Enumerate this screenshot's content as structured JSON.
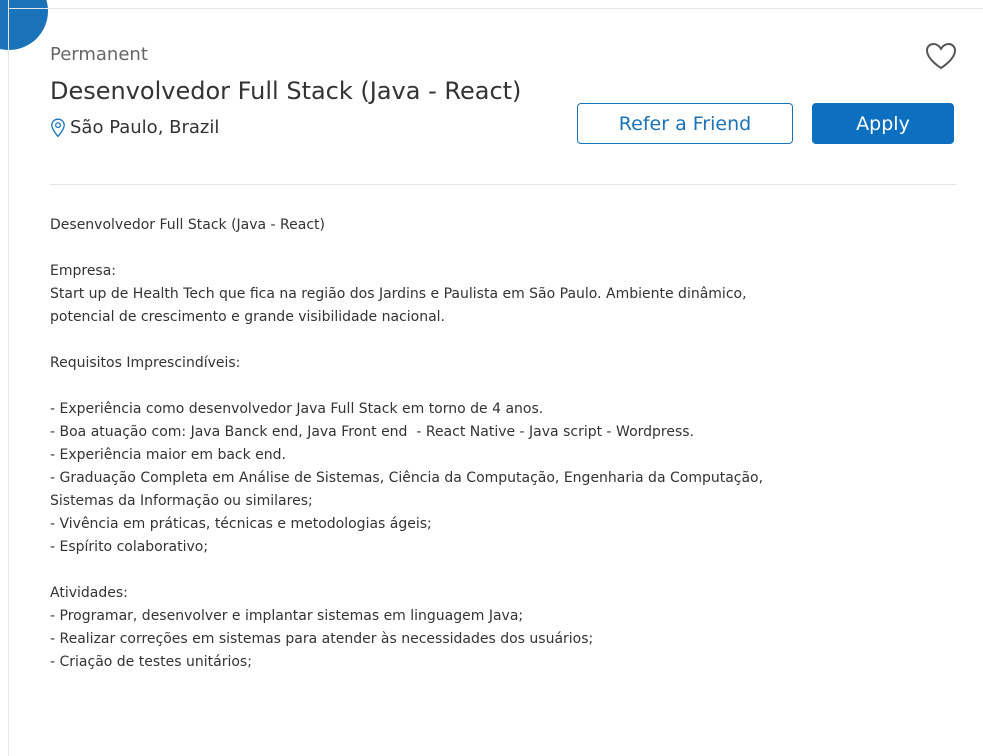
{
  "job": {
    "type": "Permanent",
    "title": "Desenvolvedor Full Stack (Java - React)",
    "location": "São Paulo, Brazil"
  },
  "actions": {
    "refer_label": "Refer a Friend",
    "apply_label": "Apply"
  },
  "icons": {
    "favorite": "heart-outline-icon",
    "location": "map-pin-icon"
  },
  "colors": {
    "accent": "#0d6fbf",
    "accent_dark": "#1a73b8",
    "text": "#333333",
    "muted": "#666666"
  },
  "description": {
    "heading": "Desenvolvedor Full Stack (Java - React)",
    "company_label": "Empresa:",
    "company_text_1": "Start up de Health Tech que fica na região dos Jardins e Paulista em São Paulo. Ambiente dinâmico,",
    "company_text_2": "potencial de crescimento e grande visibilidade nacional.",
    "requirements_label": "Requisitos Imprescindíveis:",
    "requirements": [
      "- Experiência como desenvolvedor Java Full Stack em torno de 4 anos.",
      "- Boa atuação com: Java Banck end, Java Front end  - React Native - Java script - Wordpress.",
      "- Experiência maior em back end.",
      "- Graduação Completa em Análise de Sistemas, Ciência da Computação, Engenharia da Computação,",
      "Sistemas da Informação ou similares;",
      "- Vivência em práticas, técnicas e metodologias ágeis;",
      "- Espírito colaborativo;"
    ],
    "activities_label": "Atividades:",
    "activities": [
      "- Programar, desenvolver e implantar sistemas em linguagem Java;",
      "- Realizar correções em sistemas para atender às necessidades dos usuários;",
      "- Criação de testes unitários;"
    ]
  }
}
